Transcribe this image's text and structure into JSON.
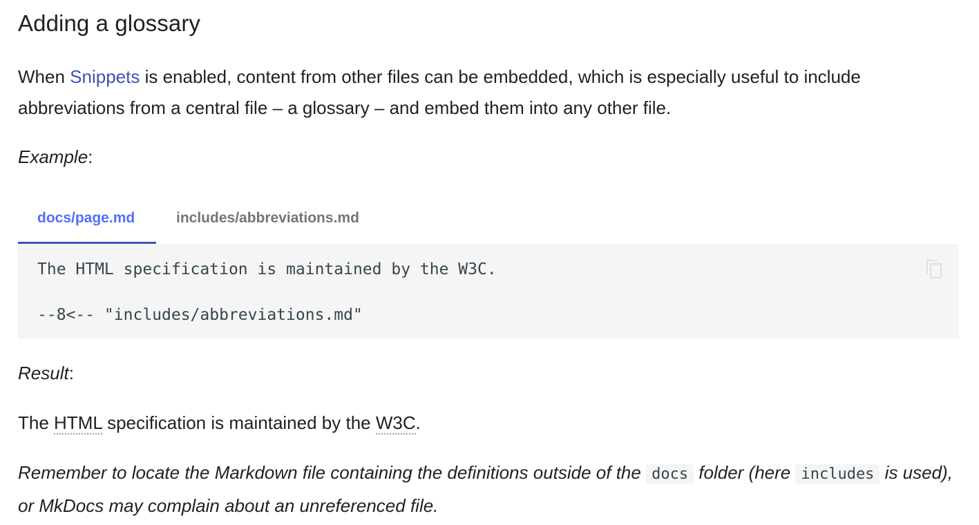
{
  "heading": "Adding a glossary",
  "intro": {
    "before_link": "When ",
    "link_text": "Snippets",
    "after_link": " is enabled, content from other files can be embedded, which is especially useful to include abbreviations from a central file – a glossary – and embed them into any other file."
  },
  "example_label": "Example",
  "example_colon": ":",
  "tabs": [
    {
      "label": "docs/page.md",
      "active": true
    },
    {
      "label": "includes/abbreviations.md",
      "active": false
    }
  ],
  "code": {
    "line1": "The HTML specification is maintained by the W3C.",
    "line2": "--8<-- \"includes/abbreviations.md\"",
    "copy_icon": "copy-icon"
  },
  "result_label": "Result",
  "result_colon": ":",
  "result": {
    "part1": "The ",
    "abbr1": "HTML",
    "part2": " specification is maintained by the ",
    "abbr2": "W3C",
    "part3": "."
  },
  "note": {
    "part1": "Remember to locate the Markdown file containing the definitions outside of the ",
    "code1": "docs",
    "part2": " folder (here ",
    "code2": "includes",
    "part3": " is used), or MkDocs may complain about an unreferenced file."
  },
  "colors": {
    "link": "#3f51b5",
    "tab_active": "#536dfe",
    "tab_inactive": "#757575",
    "code_background": "#f5f5f5"
  }
}
